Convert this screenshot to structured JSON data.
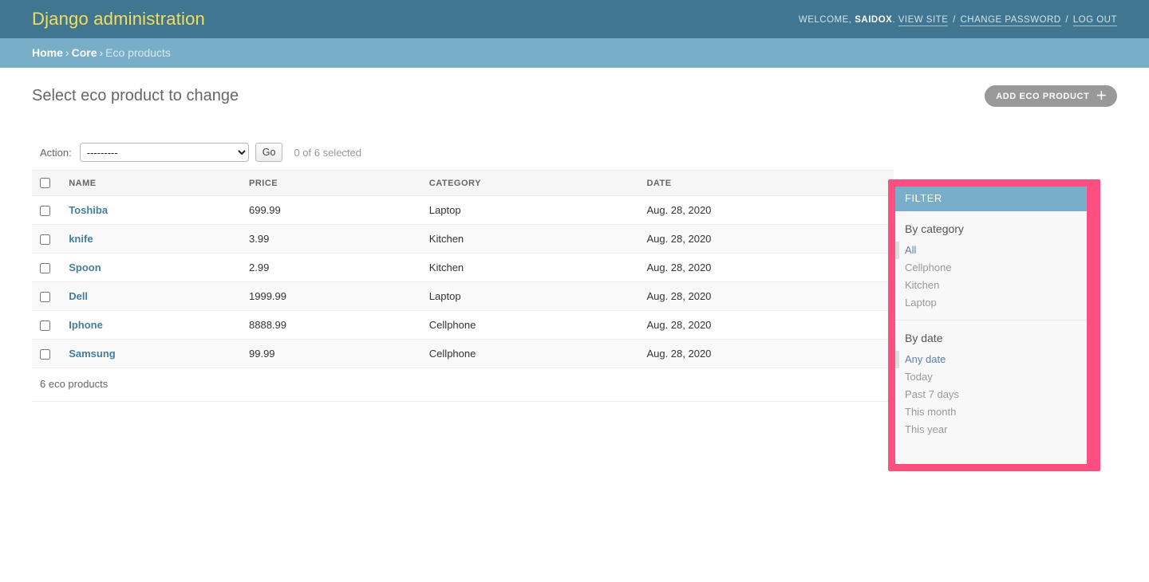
{
  "header": {
    "branding": "Django administration",
    "user_tools": {
      "welcome_prefix": "WELCOME,",
      "username": "SAIDOX",
      "period": ".",
      "view_site": "VIEW SITE",
      "change_password": "CHANGE PASSWORD",
      "log_out": "LOG OUT",
      "separator": "/"
    }
  },
  "breadcrumbs": {
    "home": "Home",
    "app": "Core",
    "current": "Eco products",
    "separator": "›"
  },
  "content": {
    "page_title": "Select eco product to change",
    "add_button": {
      "label": "ADD ECO PRODUCT",
      "icon": "plus-icon",
      "icon_glyph": "＋"
    }
  },
  "actions": {
    "label": "Action:",
    "selected_option": "---------",
    "options": [
      "---------"
    ],
    "go_label": "Go",
    "counter": "0 of 6 selected"
  },
  "table": {
    "columns": [
      "NAME",
      "PRICE",
      "CATEGORY",
      "DATE"
    ],
    "rows": [
      {
        "name": "Toshiba",
        "price": "699.99",
        "category": "Laptop",
        "date": "Aug. 28, 2020"
      },
      {
        "name": "knife",
        "price": "3.99",
        "category": "Kitchen",
        "date": "Aug. 28, 2020"
      },
      {
        "name": "Spoon",
        "price": "2.99",
        "category": "Kitchen",
        "date": "Aug. 28, 2020"
      },
      {
        "name": "Dell",
        "price": "1999.99",
        "category": "Laptop",
        "date": "Aug. 28, 2020"
      },
      {
        "name": "Iphone",
        "price": "8888.99",
        "category": "Cellphone",
        "date": "Aug. 28, 2020"
      },
      {
        "name": "Samsung",
        "price": "99.99",
        "category": "Cellphone",
        "date": "Aug. 28, 2020"
      }
    ],
    "paginator": "6 eco products"
  },
  "filter": {
    "title": "FILTER",
    "highlight_color": "#ff4f81",
    "groups": [
      {
        "heading": "By category",
        "items": [
          {
            "label": "All",
            "selected": true
          },
          {
            "label": "Cellphone",
            "selected": false
          },
          {
            "label": "Kitchen",
            "selected": false
          },
          {
            "label": "Laptop",
            "selected": false
          }
        ]
      },
      {
        "heading": "By date",
        "items": [
          {
            "label": "Any date",
            "selected": true
          },
          {
            "label": "Today",
            "selected": false
          },
          {
            "label": "Past 7 days",
            "selected": false
          },
          {
            "label": "This month",
            "selected": false
          },
          {
            "label": "This year",
            "selected": false
          }
        ]
      }
    ]
  },
  "colors": {
    "header_bg": "#417690",
    "breadcrumb_bg": "#79aec8",
    "branding_text": "#f5dd5d",
    "link": "#447e9b",
    "add_button_bg": "#999999",
    "highlight": "#ff4f81"
  }
}
